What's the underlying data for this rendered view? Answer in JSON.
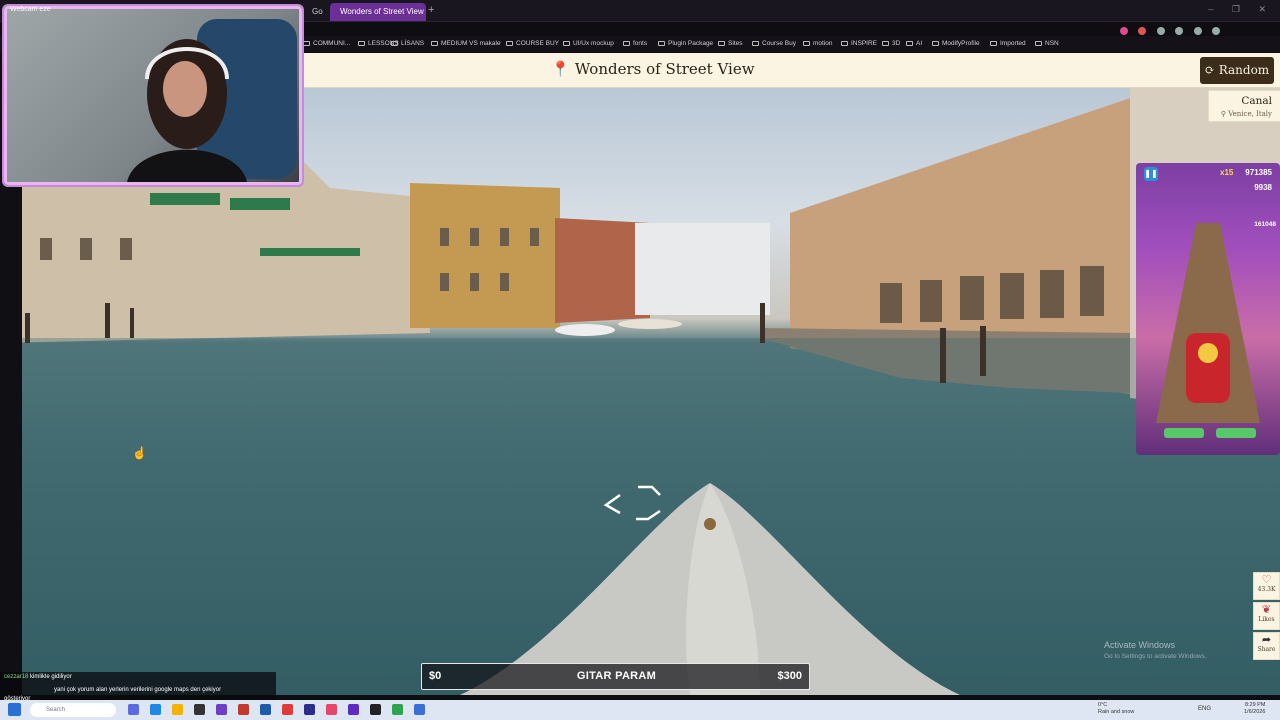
{
  "browser": {
    "tabs": [
      {
        "label": "Go"
      },
      {
        "label": "Wonders of Street View"
      }
    ],
    "new_tab_symbol": "+",
    "bookmarks": [
      "COMMUNI...",
      "LESSONS",
      "LİSANS",
      "MEDIUM VS makale",
      "COURSE BUY",
      "UI/Ux mockup",
      "fonts",
      "Plugin Package",
      "Sites",
      "Course Buy",
      "motion",
      "INSPIRE",
      "3D",
      "AI",
      "ModifyProfile",
      "Imported",
      "NSN"
    ],
    "window_controls": "– ❐ ✕"
  },
  "header": {
    "title": "Wonders of Street View",
    "pin_icon": "map-pin-icon",
    "random_label": "Random",
    "random_icon": "refresh-icon"
  },
  "location": {
    "name": "Canal",
    "place": "Venice, Italy"
  },
  "webcam": {
    "label": "Webcam eze"
  },
  "game": {
    "multiplier": "x15",
    "score": "971385",
    "coins": "9938",
    "high_score": "161048"
  },
  "social": {
    "likes_count": "43.3K",
    "likes_label": "Likes",
    "share_label": "Share"
  },
  "watermark": {
    "line1": "Activate Windows",
    "line2": "Go to Settings to activate Windows."
  },
  "money_bar": {
    "left": "$0",
    "title": "GITAR PARAM",
    "right": "$300"
  },
  "chat": {
    "line1_user": "cezzar18",
    "line1_text": "kimlikle gidiliyor",
    "line2_text": "yani çok yorum alan yerlerin verilerini google maps den çekiyor",
    "line3_text": "gösteriyor"
  },
  "taskbar": {
    "search_placeholder": "Search",
    "weather_temp": "0°C",
    "weather_desc": "Rain and snow",
    "language": "ENG",
    "time": "8:29 PM",
    "date": "1/6/2026"
  },
  "colors": {
    "header_bg": "#fbf4e2",
    "button_bg": "#3c2d1a",
    "tab_active": "#6b2f97"
  }
}
